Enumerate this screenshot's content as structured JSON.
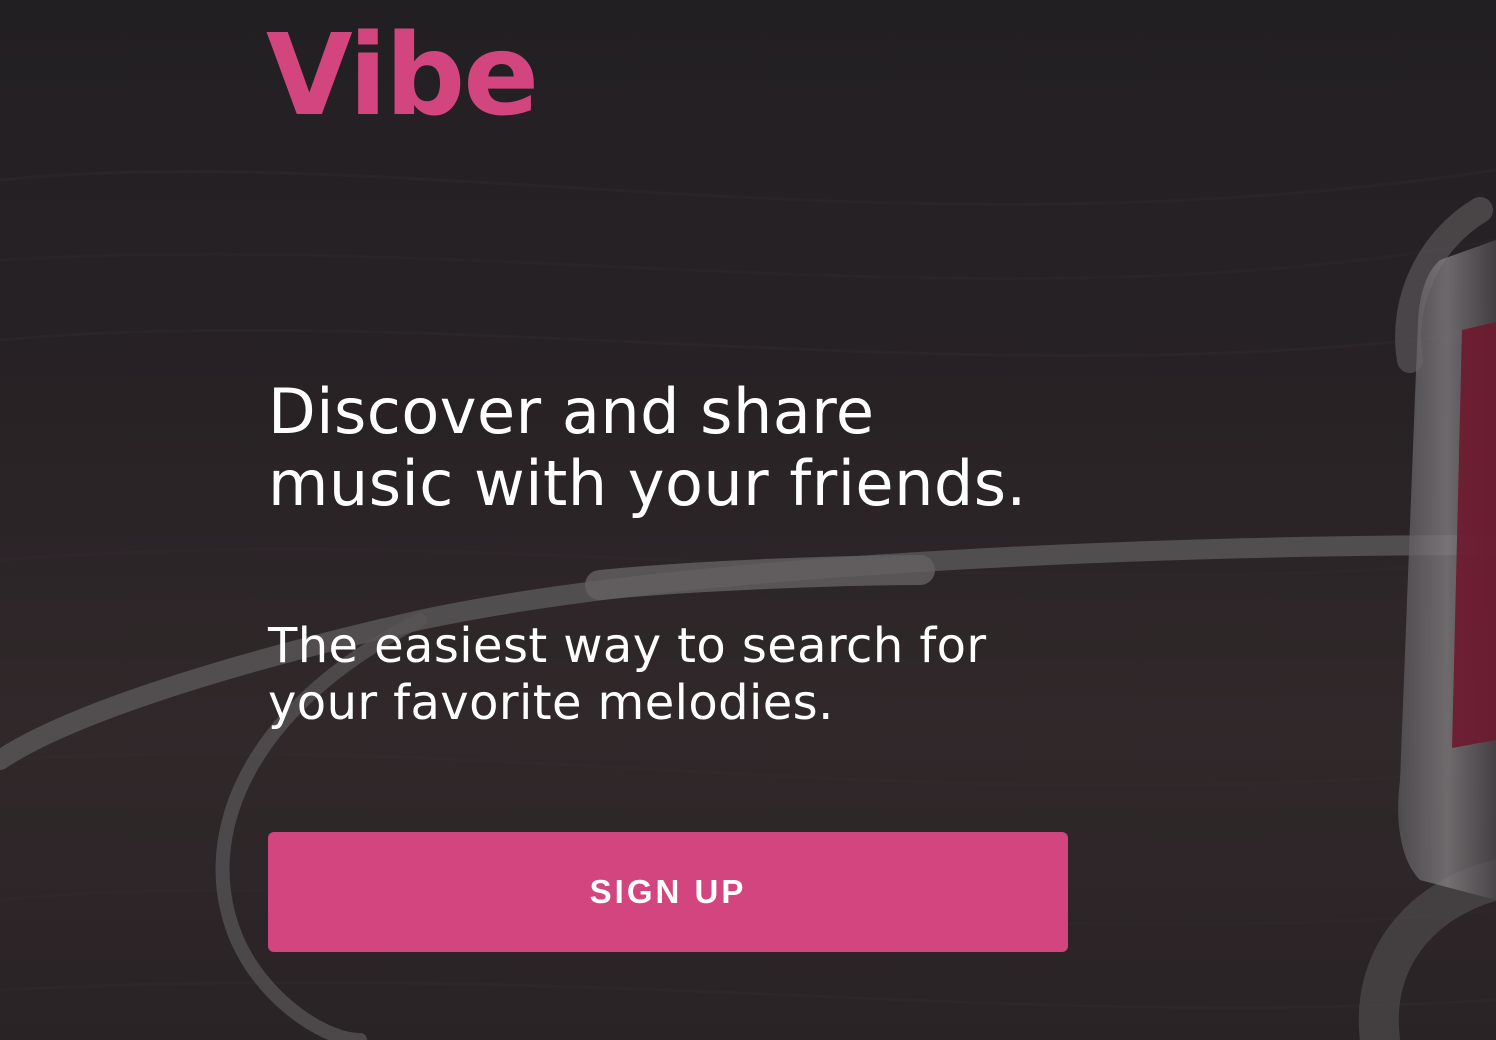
{
  "brand": {
    "name": "Vibe",
    "accent_color": "#d3457f"
  },
  "hero": {
    "headline": "Discover and share music with your friends.",
    "subheadline": "The easiest way to search for your favorite melodies.",
    "background_image": "photo-earphones-on-wooden-table"
  },
  "cta": {
    "signup_label": "SIGN UP"
  }
}
